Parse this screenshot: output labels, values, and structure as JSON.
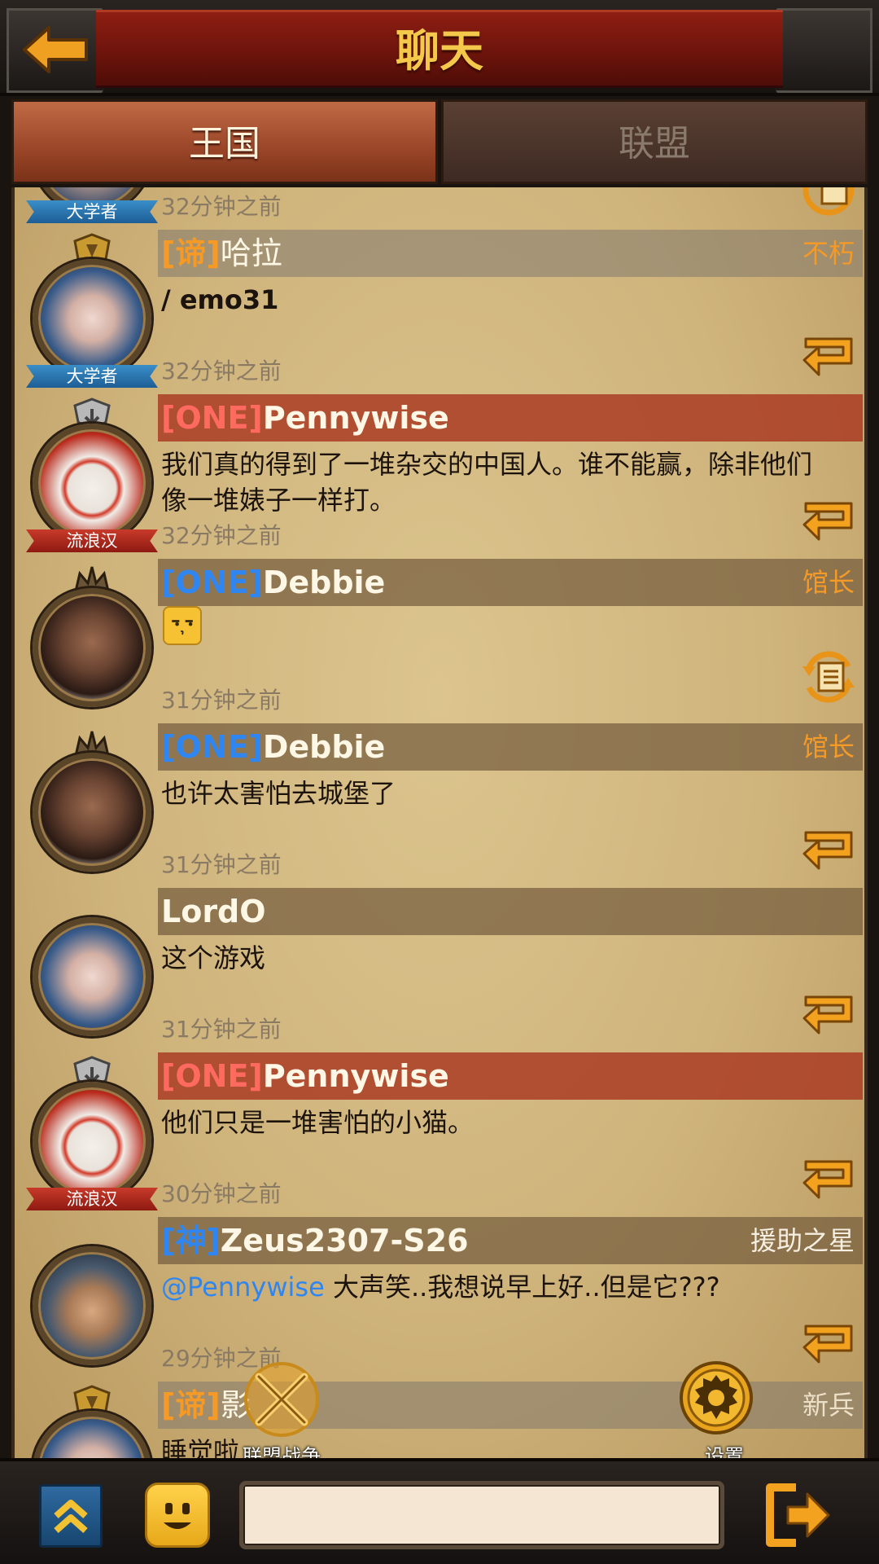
{
  "header": {
    "title": "聊天"
  },
  "tabs": [
    {
      "label": "王国",
      "active": true
    },
    {
      "label": "联盟",
      "active": false
    }
  ],
  "messages": [
    {
      "tag": "",
      "name": "",
      "role": "",
      "rank": "大学者",
      "text": "",
      "time": "32分钟之前"
    },
    {
      "tag": "[谛]",
      "name": "哈拉",
      "role": "不朽",
      "rank": "大学者",
      "text": "/ emo31",
      "time": "32分钟之前"
    },
    {
      "tag": "[ONE]",
      "name": "Pennywise",
      "role": "",
      "rank": "流浪汉",
      "text": "我们真的得到了一堆杂交的中国人。谁不能赢，除非他们像一堆婊子一样打。",
      "time": "32分钟之前"
    },
    {
      "tag": "[ONE]",
      "name": "Debbie",
      "role": "馆长",
      "rank": "",
      "text": "",
      "time": "31分钟之前"
    },
    {
      "tag": "[ONE]",
      "name": "Debbie",
      "role": "馆长",
      "rank": "",
      "text": "也许太害怕去城堡了",
      "time": "31分钟之前"
    },
    {
      "tag": "",
      "name": "LordO",
      "role": "",
      "rank": "",
      "text": "这个游戏",
      "time": "31分钟之前"
    },
    {
      "tag": "[ONE]",
      "name": "Pennywise",
      "role": "",
      "rank": "流浪汉",
      "text": "他们只是一堆害怕的小猫。",
      "time": "30分钟之前"
    },
    {
      "tag": "[神]",
      "name": "Zeus2307-S26",
      "role": "援助之星",
      "rank": "",
      "mention": "@Pennywise",
      "text": " 大声笑..我想说早上好..但是它???",
      "time": "29分钟之前"
    },
    {
      "tag": "[谛]",
      "name": "影",
      "role": "新兵",
      "rank": "",
      "text": "睡觉啦",
      "time": ""
    }
  ],
  "floating": {
    "alliance_war_label": "联盟战争",
    "settings_label": "设置"
  },
  "input": {
    "value": "",
    "placeholder": ""
  },
  "colors": {
    "title_gold": "#f4c84a",
    "tag_orange": "#f59a26",
    "tag_red": "#ff6a60",
    "tag_blue": "#2f86f0",
    "parchment": "#d2b880"
  }
}
